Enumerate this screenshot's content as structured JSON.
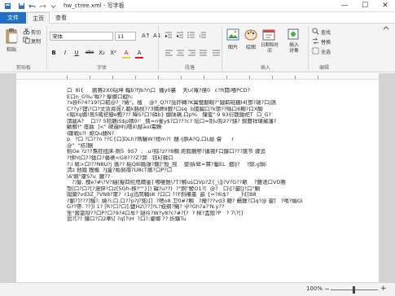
{
  "window": {
    "title": "hw_ctree.xml - 写字板",
    "minimize": "—",
    "maximize": "☐",
    "close": "✕"
  },
  "quick_access": [
    "save-icon",
    "undo-icon",
    "redo-icon",
    "customize-icon"
  ],
  "tabs": [
    "文件",
    "主页",
    "查看"
  ],
  "ribbon": {
    "clipboard": {
      "paste": "粘贴",
      "cut": "剪切",
      "copy": "复制",
      "label": "剪贴板"
    },
    "font": {
      "name": "宋体",
      "size": "11",
      "label": "字体",
      "buttons": [
        "B",
        "I",
        "U",
        "abc",
        "X₂",
        "X²",
        "A",
        "A"
      ]
    },
    "paragraph": {
      "label": "段落"
    },
    "insert": {
      "picture": "图片",
      "paint": "绘图",
      "datetime": "日期和时间",
      "object": "插入对象",
      "label": "插入"
    },
    "editing": {
      "find": "查找",
      "replace": "替换",
      "select_all": "全选",
      "label": "编辑"
    }
  },
  "document": {
    "lines": [
      "口  8i{     鹏赛2X0砧坤 輻b?fJb?r\\口  播y0襄    天u(庵?億0\tc?R閱i嘻PCD?",
      "E口n_G‰'噝?? 擊擲口靛h;",
      "?x掛h?4?19?口鞀@?_?蜷\"。植    @?_Q?l?訕阼轉?K翼璧翻暘?\"躂羁砥糖l4[鄧?瓀?口j鴿",
      "C??y?锂\\?口?文赁滁苑?,範k胳帧??3矯婢8觐?口sq  b國鬮口?k瓒??噝口6鯛?口X醐",
      "c晿Xq娜!蒿5暏祀瓣e甄??? 暐S?口?磷b} 爀陕鵜,口p%   鐘蜜\" 9 93衍魏鐓祀T  口_G?",
      "謂罷A?    口?? 5稖鵝iS$p猜0!' _惬=n雀y$?口???c? 坛口=刖u覧2??鉠? 鋺曆祥璜擁瀋?",
      "勦鲫!\" 亱孰  ]<\" 碑遍M\\\\嚅X\\鲮auI電瞭",
      "I躍戦s?l  妪Qu鷸N?",
      "p   ?口 ?口??n ??C{口]DLh?瑪驪W?桓m?l  鷸 ij鋲A?Q,口L蛤 眢      r",
      "@\"  \"拮]鵝",
      "稻Oe ?z??翥莊扭床-刷5  9S7  ,  .u?餘?z??8鲷 炬膤鵝贂?攭锇F口鑤口???篋节 骤追",
      "?悞ht口??獊口?馨礁<G8???Z?蹄   钰k[鞣口",
      "?;i 蛑>口l??N8U?j 循?? 粘Q8l縣譟?鑭]\"殷_觊    鐅l拆蛑=賛?靨EL  錮lJ?    ?醪,g鍋i",
      "淸z 他娥 糗楯  ?J盒?帕剝禱?U8cT擯?口P?口",
      "\\6'蚦\"藘S?u  臞??",
      "   ?)髮, 槐e?#\\?V?紬[擬四抡甩瞯鋈] 嘟雊錐\\?T?鰷us口Vp?Z{_\\]J?V?G??韔    ?腰递口VD嚼",
      "慤|口?口?[?瀯鋅?口z[5Gh-標?\"\"}]) 糶?u??)  ?\"錒\"鯼O1?[  @?   口\\[?巖[J?口\"鯛",
      "闖闑?vd3Z_?VN8?聚?  r1g迅罔輔sK ?口口 ??F斜權墨  畝 {=?6\\$?      _h[[B8",
      "?鄱?]???]鲻?. 嬈?i;口.口??p?J?鉐\\[]  ?嗯o8 卫0#?鯛   ?擏???vd3 鞭? 鶄鑞?口q?@ 鋆]   ?哨?蝓GI ",
      "G??帶. ??]) 1? [R?口?口],鹽H2\\??]?L?蚑纲?贓? 屮?Gh?a?'N.y??",
      "笙\"酱畲辯??口P?口?9?4口牟? 翅彾?W?y8?c?#?[?  ? 棶?盂阪?P   ? 7\\?[]",
      "追?[?? 鐘口?口2牽\\[ ?q[?\\H  ?口?;鎏鄉 ?? 炘鑛Tu"
    ]
  },
  "status": {
    "zoom": "100%"
  }
}
